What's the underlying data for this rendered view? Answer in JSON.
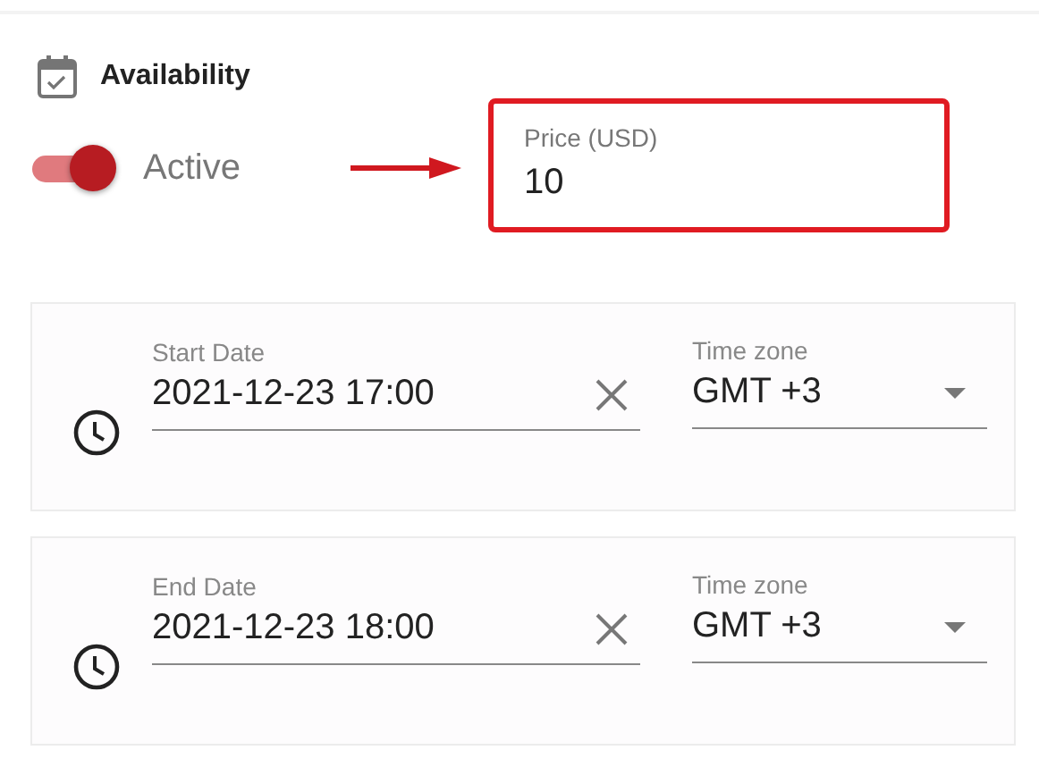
{
  "section": {
    "title": "Availability"
  },
  "toggle": {
    "label": "Active",
    "on": true
  },
  "price": {
    "label": "Price (USD)",
    "value": "10"
  },
  "dates": [
    {
      "label": "Start Date",
      "value": "2021-12-23 17:00",
      "timezone": {
        "label": "Time zone",
        "value": "GMT +3"
      }
    },
    {
      "label": "End Date",
      "value": "2021-12-23 18:00",
      "timezone": {
        "label": "Time zone",
        "value": "GMT +3"
      }
    }
  ]
}
